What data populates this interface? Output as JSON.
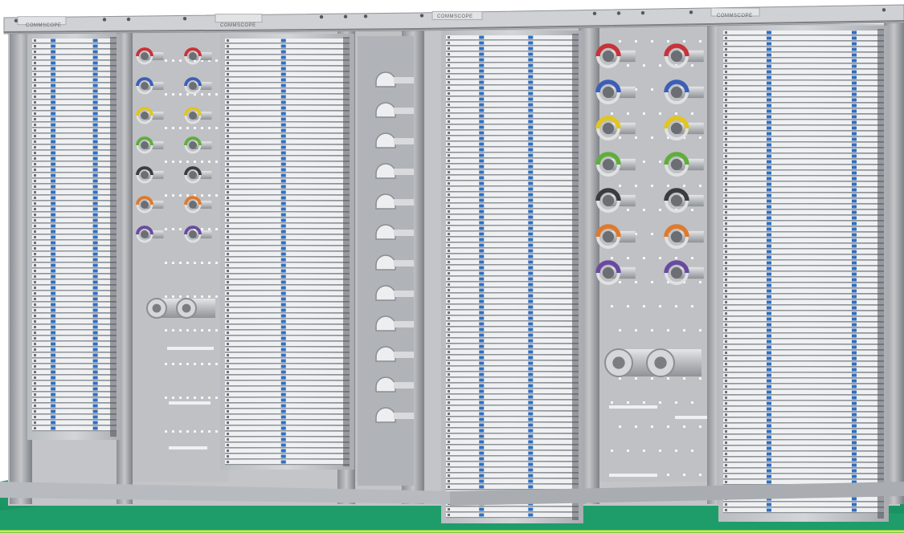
{
  "scene": {
    "subject": "fiber-distribution-frame",
    "brand_labels": [
      "COMMSCOPE",
      "COMMSCOPE",
      "COMMSCOPE",
      "COMMSCOPE"
    ]
  },
  "colors": {
    "frame_light": "#cfd1d4",
    "frame_mid": "#9a9da2",
    "frame_dark": "#5b5e63",
    "panel_white": "#eef0f2",
    "port_blue": "#2f6fc3",
    "floor_green": "#1f9e6c",
    "accent_yellow_green": "#d7e93a"
  },
  "cable_guides": [
    {
      "color_name": "red",
      "hex": "#c8323a"
    },
    {
      "color_name": "blue",
      "hex": "#3b5fb8"
    },
    {
      "color_name": "yellow",
      "hex": "#e2c51f"
    },
    {
      "color_name": "green",
      "hex": "#5fae3a"
    },
    {
      "color_name": "black",
      "hex": "#3a3c40"
    },
    {
      "color_name": "orange",
      "hex": "#df7a2c"
    },
    {
      "color_name": "violet",
      "hex": "#6a4aa0"
    }
  ]
}
